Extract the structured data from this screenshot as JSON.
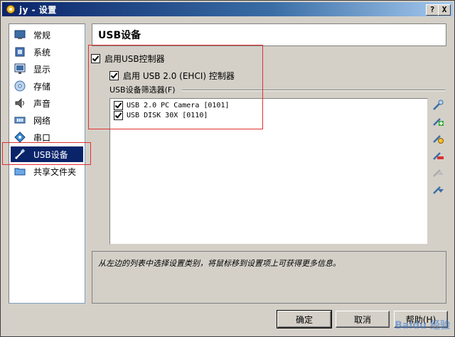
{
  "window": {
    "title": "jy - 设置",
    "help_button": "?",
    "close_button": "X"
  },
  "nav": {
    "items": [
      {
        "label": "常规",
        "icon": "monitor-icon"
      },
      {
        "label": "系统",
        "icon": "chip-icon"
      },
      {
        "label": "显示",
        "icon": "display-icon"
      },
      {
        "label": "存储",
        "icon": "disk-icon"
      },
      {
        "label": "声音",
        "icon": "speaker-icon"
      },
      {
        "label": "网络",
        "icon": "network-icon"
      },
      {
        "label": "串口",
        "icon": "serial-port-icon"
      },
      {
        "label": "USB设备",
        "icon": "usb-icon",
        "selected": true
      },
      {
        "label": "共享文件夹",
        "icon": "folder-icon"
      }
    ]
  },
  "page": {
    "title": "USB设备",
    "enable_usb_controller": {
      "label": "启用USB控制器",
      "checked": true
    },
    "enable_ehci": {
      "label": "启用 USB 2.0 (EHCI) 控制器",
      "checked": true
    },
    "filter_group_title": "USB设备筛选器(F)",
    "filters": [
      {
        "label": "USB 2.0 PC Camera [0101]",
        "checked": true
      },
      {
        "label": "USB DISK 30X [0110]",
        "checked": true
      }
    ],
    "tools": [
      "add-filter-icon",
      "add-from-device-icon",
      "edit-filter-icon",
      "remove-filter-icon",
      "move-up-icon",
      "move-down-icon"
    ],
    "info_text": "从左边的列表中选择设置类别，将鼠标移到设置项上可获得更多信息。"
  },
  "buttons": {
    "ok": "确定",
    "cancel": "取消",
    "help": "帮助(H)"
  },
  "watermark": "Baidu 经验",
  "colors": {
    "selection": "#0a246a",
    "highlight_box": "#e03030"
  }
}
